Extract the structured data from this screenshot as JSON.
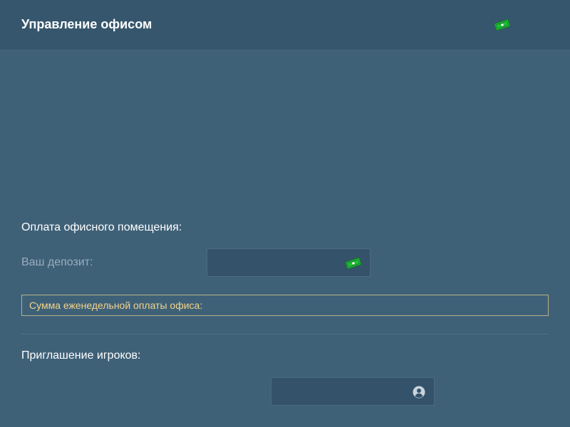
{
  "header": {
    "title": "Управление офисом",
    "money_icon": "money-bill-icon"
  },
  "office_payment": {
    "section_label": "Оплата офисного помещения:",
    "deposit_label": "Ваш депозит:",
    "deposit_value": "",
    "deposit_icon": "money-bill-icon",
    "weekly_notice": "Сумма еженедельной оплаты офиса:"
  },
  "invite": {
    "section_label": "Приглашение игроков:",
    "player_value": "",
    "player_icon": "user-circle-icon"
  },
  "colors": {
    "background": "#3f6178",
    "header_background": "#36566d",
    "input_background": "#34536a",
    "notice_text": "#f2d48a",
    "notice_border": "#b7b08a",
    "money_green": "#2ecc40"
  }
}
